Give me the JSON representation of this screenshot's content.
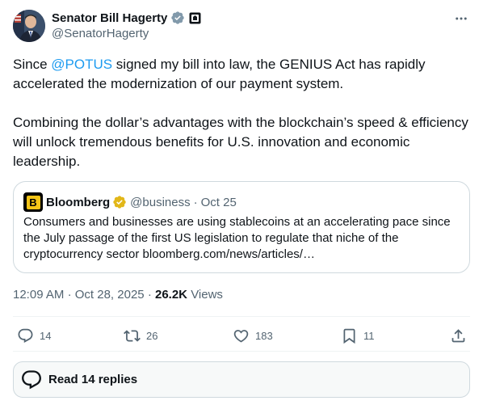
{
  "author": {
    "name": "Senator Bill Hagerty",
    "handle": "@SenatorHagerty",
    "verified_color": "#829aab",
    "badge": "government-affiliation-badge"
  },
  "post": {
    "line1_prefix": "Since ",
    "mention": "@POTUS",
    "line1_suffix": " signed my bill into law, the GENIUS Act has rapidly accelerated the modernization of our payment system.",
    "paragraph2": "Combining the dollar’s advantages with the blockchain’s speed & efficiency will unlock tremendous benefits for U.S. innovation and economic leadership."
  },
  "quote": {
    "logo_letter": "B",
    "name": "Bloomberg",
    "handle": "@business",
    "separator": "·",
    "date": "Oct 25",
    "text": "Consumers and businesses are using stablecoins at an accelerating pace since the July passage of the first US legislation to regulate that niche of the cryptocurrency sector bloomberg.com/news/articles/…"
  },
  "meta": {
    "time": "12:09 AM",
    "separator": "·",
    "date": "Oct 28, 2025",
    "views_count": "26.2K",
    "views_label": "Views"
  },
  "actions": {
    "replies": "14",
    "reposts": "26",
    "likes": "183",
    "bookmarks": "11"
  },
  "replies_button": {
    "label": "Read 14 replies"
  },
  "colors": {
    "accent": "#1d9bf0",
    "text": "#0f1419",
    "muted": "#536471",
    "border": "#cfd9de",
    "gold": "#e2b719"
  }
}
